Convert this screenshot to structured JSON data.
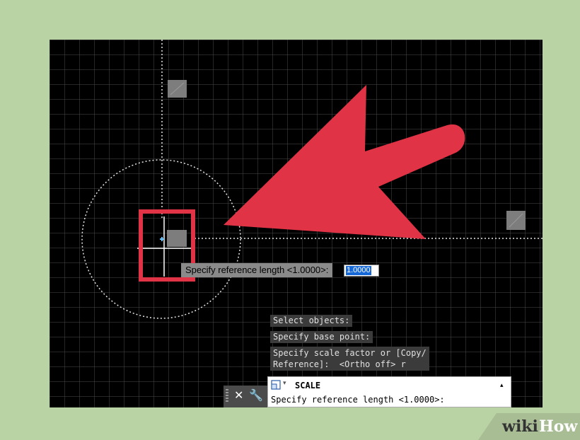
{
  "tooltip": {
    "text": "Specify reference length <1.0000>:"
  },
  "dynamic_input": {
    "value": "1.0000"
  },
  "history": {
    "line1": "Select objects:",
    "line2": "Specify base point:",
    "line3a": "Specify scale factor or [Copy/",
    "line3b": "Reference]:  <Ortho off> r"
  },
  "command_line": {
    "command": "SCALE",
    "prompt": "Specify reference length <1.0000>:",
    "close_glyph": "✕",
    "customize_glyph": "🔧",
    "arrow_glyph": "▾",
    "recent_glyph": "▴"
  },
  "branding": {
    "wiki": "wiki",
    "how": "How"
  },
  "colors": {
    "background": "#b9d3a5",
    "canvas": "#000000",
    "annotation_red": "#e03345",
    "highlight": "#1668d6"
  }
}
